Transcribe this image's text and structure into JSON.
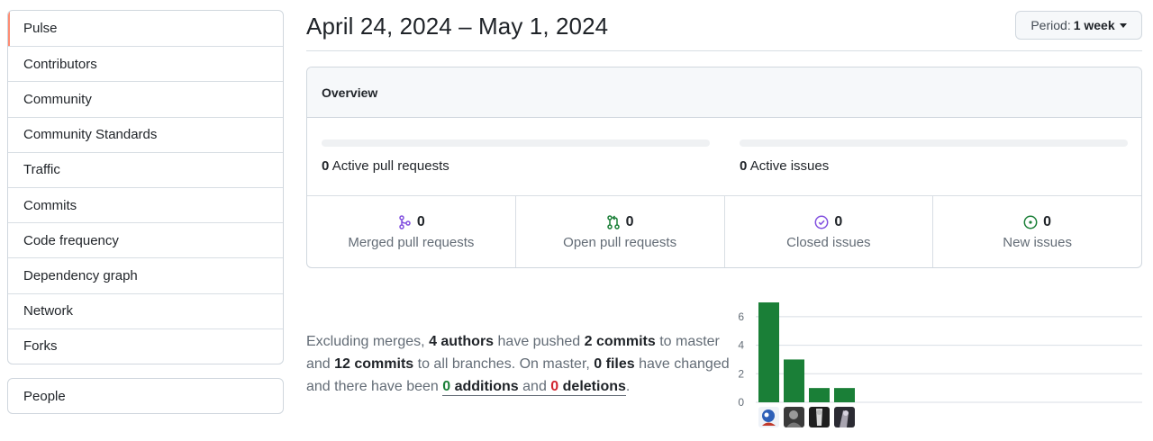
{
  "sidebar": {
    "items": [
      {
        "label": "Pulse",
        "selected": true
      },
      {
        "label": "Contributors"
      },
      {
        "label": "Community"
      },
      {
        "label": "Community Standards"
      },
      {
        "label": "Traffic"
      },
      {
        "label": "Commits"
      },
      {
        "label": "Code frequency"
      },
      {
        "label": "Dependency graph"
      },
      {
        "label": "Network"
      },
      {
        "label": "Forks"
      }
    ],
    "secondary_items": [
      {
        "label": "People"
      }
    ]
  },
  "header": {
    "date_range": "April 24, 2024 – May 1, 2024",
    "period_label": "Period:",
    "period_value": "1 week"
  },
  "overview": {
    "title": "Overview",
    "active_pull_requests": {
      "count": "0",
      "label": "Active pull requests"
    },
    "active_issues": {
      "count": "0",
      "label": "Active issues"
    },
    "stats": [
      {
        "icon": "merge-icon",
        "count": "0",
        "label": "Merged pull requests",
        "color": "#8250df"
      },
      {
        "icon": "pull-request-icon",
        "count": "0",
        "label": "Open pull requests",
        "color": "#1a7f37"
      },
      {
        "icon": "closed-issue-icon",
        "count": "0",
        "label": "Closed issues",
        "color": "#8250df"
      },
      {
        "icon": "open-issue-icon",
        "count": "0",
        "label": "New issues",
        "color": "#1a7f37"
      }
    ]
  },
  "summary": {
    "t1": "Excluding merges, ",
    "authors": "4 authors",
    "t2": " have pushed ",
    "commits_master": "2 commits",
    "t3": " to master and ",
    "commits_all": "12 commits",
    "t4": " to all branches. On master, ",
    "files": "0 files",
    "t5": " have changed and there have been ",
    "additions": "0",
    "additions_word": " additions",
    "and_word": " and ",
    "deletions": "0",
    "deletions_word": " deletions",
    "t6": "."
  },
  "chart_data": {
    "type": "bar",
    "categories": [
      "author-1",
      "author-2",
      "author-3",
      "author-4"
    ],
    "values": [
      7,
      3,
      1,
      1
    ],
    "yticks": [
      0,
      2,
      4,
      6
    ],
    "ylim": [
      0,
      7
    ],
    "bar_color": "#1a7f37",
    "grid": true
  }
}
